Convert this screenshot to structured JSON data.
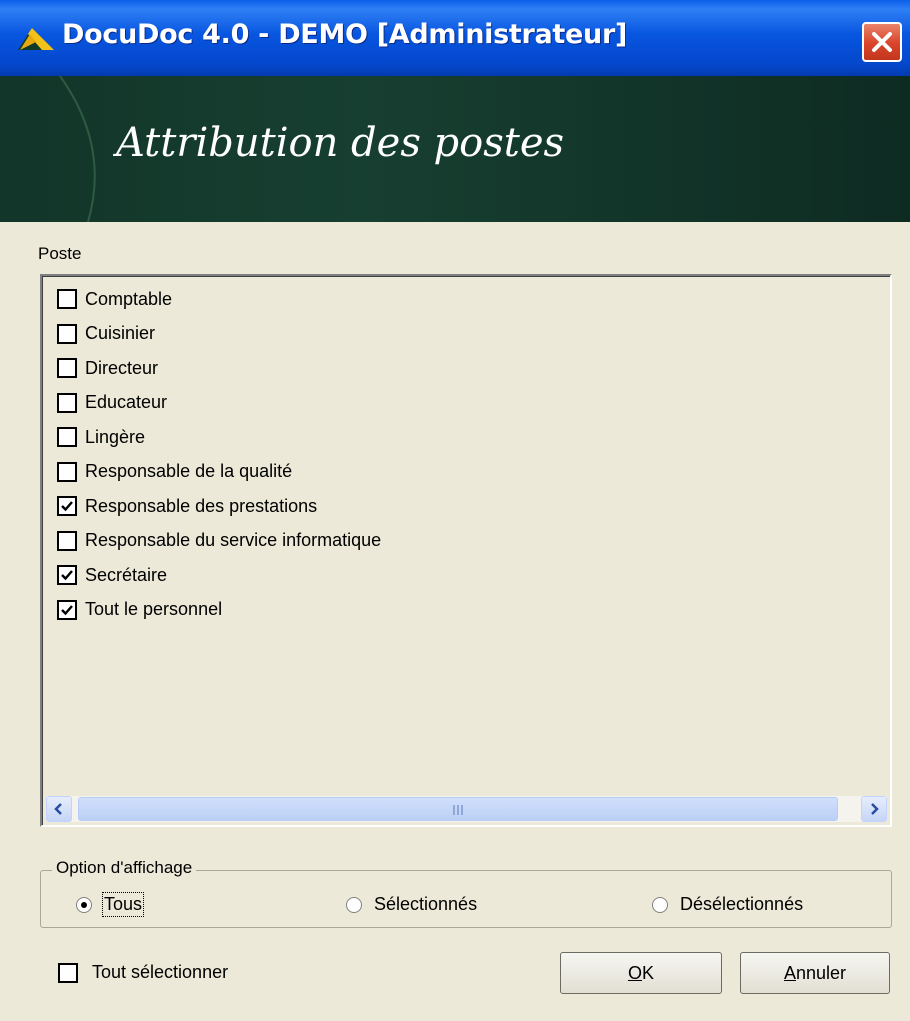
{
  "window": {
    "title": "DocuDoc 4.0 - DEMO [Administrateur]"
  },
  "banner": {
    "title": "Attribution des postes"
  },
  "poste_list": {
    "label": "Poste",
    "items": [
      {
        "label": "Comptable",
        "checked": false
      },
      {
        "label": "Cuisinier",
        "checked": false
      },
      {
        "label": "Directeur",
        "checked": false
      },
      {
        "label": "Educateur",
        "checked": false
      },
      {
        "label": "Lingère",
        "checked": false
      },
      {
        "label": "Responsable de la qualité",
        "checked": false
      },
      {
        "label": "Responsable des prestations",
        "checked": true
      },
      {
        "label": "Responsable du service informatique",
        "checked": false
      },
      {
        "label": "Secrétaire",
        "checked": true
      },
      {
        "label": "Tout le personnel",
        "checked": true
      }
    ]
  },
  "display_option": {
    "legend": "Option d'affichage",
    "selected": "Tous",
    "options": [
      {
        "label": "Tous",
        "selected": true
      },
      {
        "label": "Sélectionnés",
        "selected": false
      },
      {
        "label": "Désélectionnés",
        "selected": false
      }
    ]
  },
  "select_all": {
    "label": "Tout sélectionner",
    "checked": false
  },
  "buttons": {
    "ok_mnemonic": "O",
    "ok_rest": "K",
    "cancel_mnemonic": "A",
    "cancel_rest": "nnuler"
  },
  "colors": {
    "titlebar": "#0856e0",
    "banner": "#173f31",
    "dialog_bg": "#ece9d8",
    "close_button": "#d9442a"
  }
}
